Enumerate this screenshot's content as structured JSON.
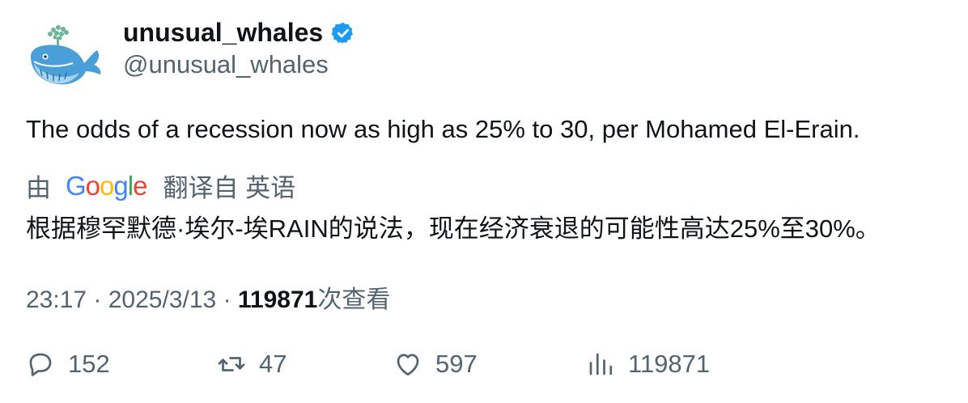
{
  "author": {
    "display_name": "unusual_whales",
    "handle": "@unusual_whales",
    "verified": true,
    "verified_color": "#1d9bf0"
  },
  "tweet": {
    "text": "The odds of a recession now as high as 25% to 30, per Mohamed El-Erain."
  },
  "translation": {
    "by_label": "由",
    "provider": "Google",
    "from_label": "翻译自 英语",
    "text": "根据穆罕默德·埃尔-埃RAIN的说法，现在经济衰退的可能性高达25%至30%。"
  },
  "meta": {
    "time": "23:17",
    "separator": "·",
    "date": "2025/3/13",
    "views_count": "119871",
    "views_suffix": "次查看"
  },
  "actions": {
    "replies": "152",
    "retweets": "47",
    "likes": "597",
    "views": "119871"
  },
  "icons": {
    "avatar": "whale-logo-icon",
    "verified": "verified-badge-icon",
    "reply": "reply-icon",
    "retweet": "retweet-icon",
    "like": "heart-icon",
    "views": "views-chart-icon"
  }
}
